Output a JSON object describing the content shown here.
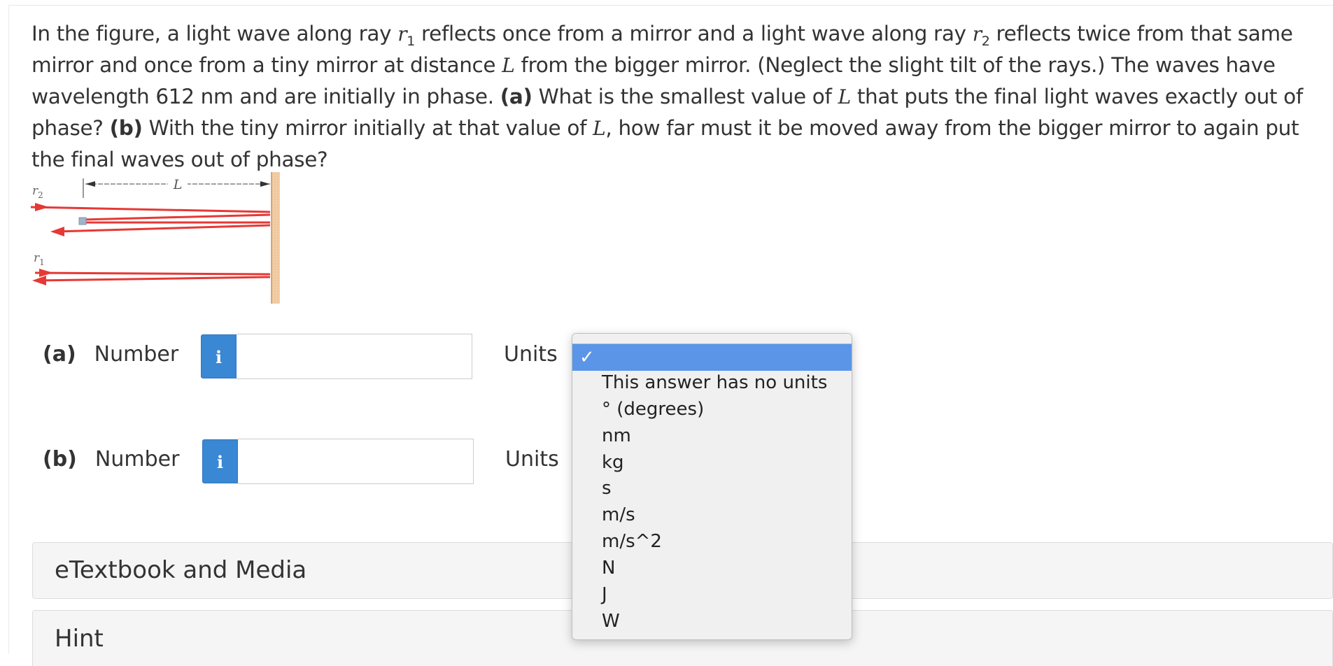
{
  "question": {
    "t1": "In the figure, a light wave along ray ",
    "r": "r",
    "one": "1",
    "t2": " reflects once from a mirror and a light wave along ray ",
    "two": "2",
    "t3": " reflects twice from that same mirror and once from a tiny mirror at distance ",
    "L": "L",
    "t4": " from the bigger mirror. (Neglect the slight tilt of the rays.) The waves have wavelength 612 nm and are initially in phase. ",
    "a": "(a)",
    "t5": " What is the smallest value of ",
    "t6": " that puts the final light waves exactly out of phase? ",
    "b": "(b)",
    "t7": " With the tiny mirror initially at that value of ",
    "t8": ", how far must it be moved away from the bigger mirror to again put the final waves out of phase?"
  },
  "figure": {
    "label_L": "L",
    "label_r2": "r",
    "label_r2_sub": "2",
    "label_r1": "r",
    "label_r1_sub": "1"
  },
  "parts": [
    {
      "letter": "(a)",
      "label": "Number",
      "info": "i",
      "value": "",
      "units_label": "Units"
    },
    {
      "letter": "(b)",
      "label": "Number",
      "info": "i",
      "value": "",
      "units_label": "Units"
    }
  ],
  "units_dropdown": {
    "checkmark": "✓",
    "selected": "",
    "options": [
      "This answer has no units",
      "° (degrees)",
      "nm",
      "kg",
      "s",
      "m/s",
      "m/s^2",
      "N",
      "J",
      "W"
    ]
  },
  "panels": {
    "etextbook": "eTextbook and Media",
    "hint": "Hint"
  },
  "colors": {
    "info_button": "#3a87d4",
    "dropdown_selected": "#5b95e8",
    "ray": "#e53935",
    "mirror": "#f2c9a0"
  }
}
